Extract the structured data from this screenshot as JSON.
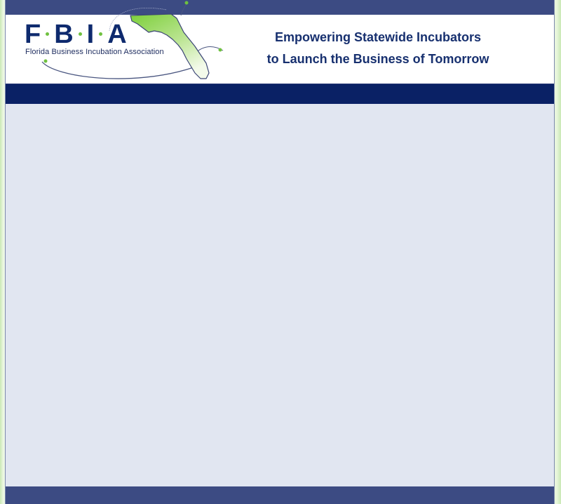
{
  "logo": {
    "letters": [
      "F",
      "B",
      "I",
      "A"
    ],
    "subtitle": "Florida Business Incubation Association",
    "icon": "florida-map-icon"
  },
  "header": {
    "tagline_line1": "Empowering Statewide Incubators",
    "tagline_line2": "to Launch the Business of Tomorrow"
  },
  "colors": {
    "top_strip": "#3c4b83",
    "nav_bar": "#0a2165",
    "content_bg": "#e1e6f1",
    "logo_text": "#0e2a6e",
    "accent_green": "#6fc13f",
    "tagline": "#17306f",
    "page_side": "#e8f6dc"
  }
}
